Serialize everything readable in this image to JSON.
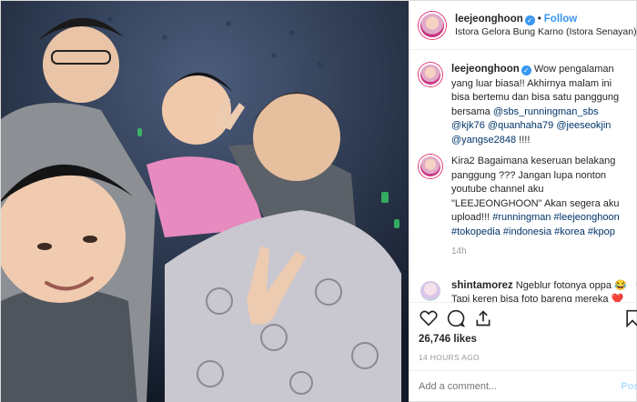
{
  "header": {
    "username": "leejeonghoon",
    "follow_label": "Follow",
    "location": "Istora Gelora Bung Karno (Istora Senayan)",
    "separator": "•"
  },
  "caption": {
    "username": "leejeonghoon",
    "text_part1": "Wow pengalaman yang luar biasa!! Akhirnya malam ini bisa bertemu dan bisa satu panggung bersama ",
    "mention1": "@sbs_runningman_sbs",
    "mention2": "@kjk76",
    "mention3": "@quanhaha79",
    "mention4": "@jeeseokjin",
    "mention5": "@yangse2848",
    "text_part2": " !!!!"
  },
  "comment_reply": {
    "text": "Kira2 Bagaimana keseruan belakang panggung ??? Jangan lupa nonton youtube channel aku \"LEEJEONGHOON\" Akan segera aku upload!!! ",
    "tags": [
      "#runningman",
      "#leejeonghoon",
      "#tokopedia",
      "#indonesia",
      "#korea",
      "#kpop"
    ],
    "timestamp": "14h"
  },
  "comment2": {
    "username": "shintamorez",
    "text": " Ngeblur fotonya oppa 😂 Tapi keren bisa foto bareng mereka ❤️"
  },
  "likes": "26,746 likes",
  "time_ago": "14 HOURS AGO",
  "add_comment": {
    "placeholder": "Add a comment...",
    "post_label": "Post"
  }
}
